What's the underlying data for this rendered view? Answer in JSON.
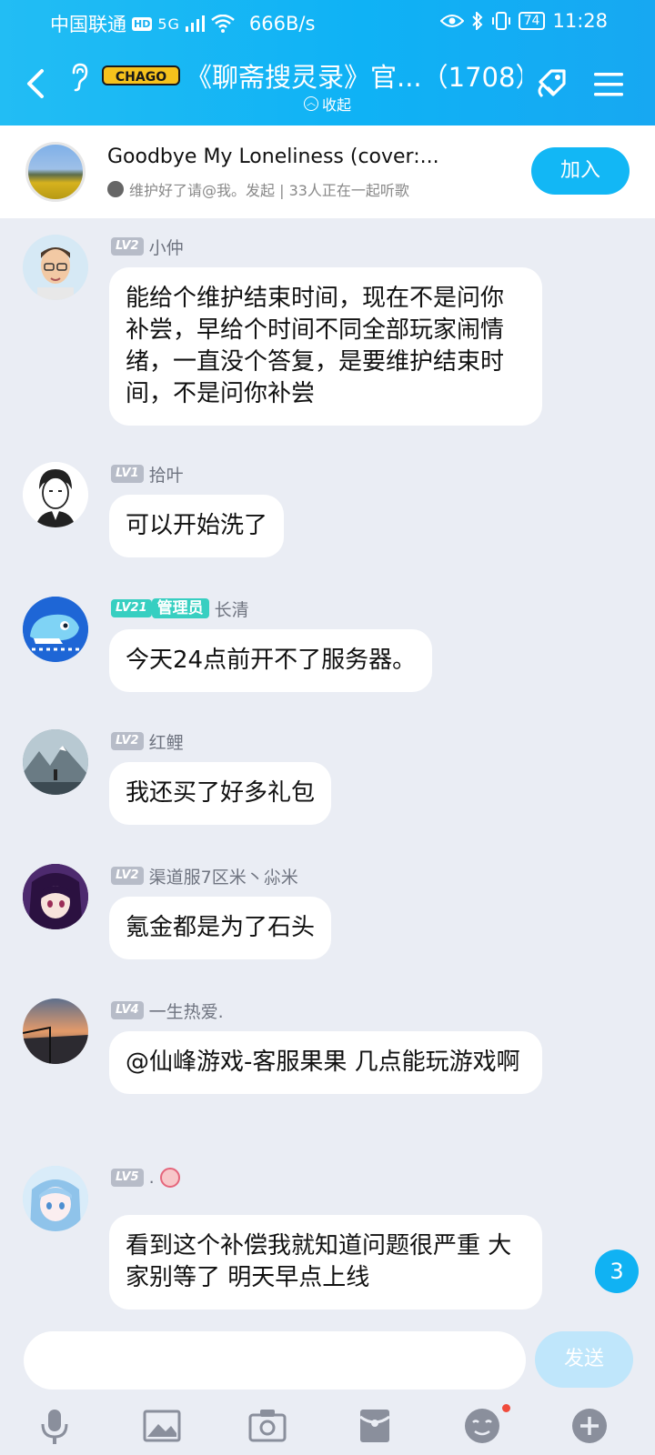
{
  "status_bar": {
    "carrier": "中国联通",
    "hd": "HD",
    "signal": "5G",
    "speed": "666B/s",
    "battery": "74",
    "time": "11:28"
  },
  "header": {
    "logo_text": "CHAGO",
    "title": "《聊斋搜灵录》官...（1708）",
    "collapse_label": "收起"
  },
  "music": {
    "title": "Goodbye My Loneliness (cover:...",
    "subtitle": "维护好了请@我。发起 | 33人正在一起听歌",
    "join_label": "加入"
  },
  "messages": [
    {
      "level": "LV2",
      "name": "小仲",
      "role": "",
      "text": "能给个维护结束时间，现在不是问你补尝，早给个时间不同全部玩家闹情绪，一直没个答复，是要维护结束时间，不是问你补尝"
    },
    {
      "level": "LV1",
      "name": "拾叶",
      "role": "",
      "text": "可以开始洗了"
    },
    {
      "level": "LV21",
      "name": "长清",
      "role": "管理员",
      "text": "今天24点前开不了服务器。"
    },
    {
      "level": "LV2",
      "name": "红鲤",
      "role": "",
      "text": "我还买了好多礼包"
    },
    {
      "level": "LV2",
      "name": "渠道服7区米丶尛米",
      "role": "",
      "text": "氪金都是为了石头"
    },
    {
      "level": "LV4",
      "name": "一生热爱.",
      "role": "",
      "text": "@仙峰游戏-客服果果 几点能玩游戏啊"
    },
    {
      "level": "LV5",
      "name": ".",
      "role": "",
      "text": "看到这个补偿我就知道问题很严重  大家别等了    明天早点上线"
    }
  ],
  "unread_count": "3",
  "input": {
    "placeholder": "",
    "send_label": "发送"
  },
  "colors": {
    "accent": "#12b7f5",
    "admin": "#37cfc1",
    "background": "#eaedf4"
  }
}
